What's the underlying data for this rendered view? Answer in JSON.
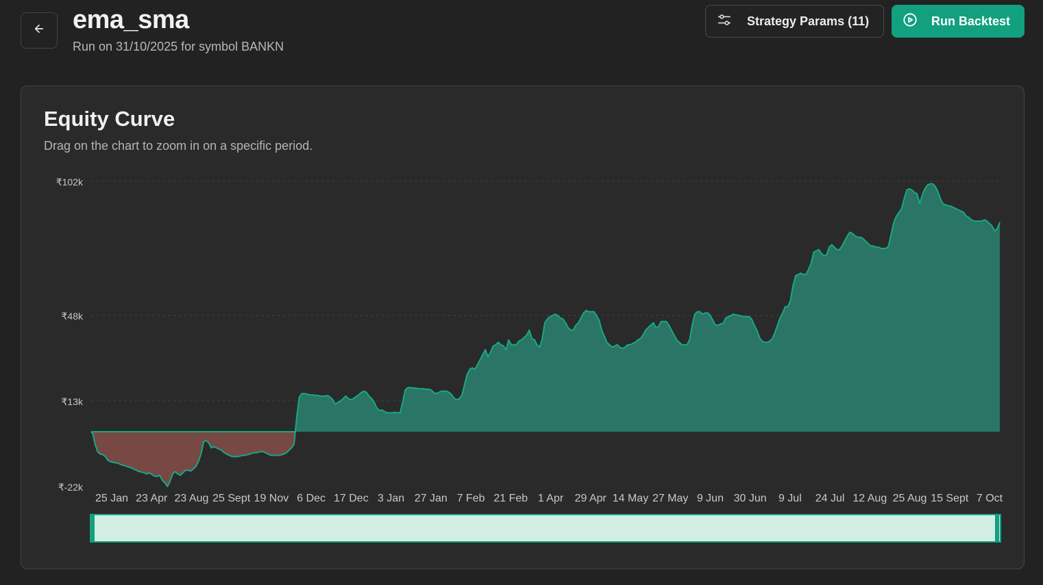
{
  "header": {
    "title": "ema_sma",
    "subtitle": "Run on 31/10/2025 for symbol BANKN",
    "back_icon": "arrow-left-icon",
    "params_label": "Strategy Params (11)",
    "params_icon": "sliders-icon",
    "run_label": "Run Backtest",
    "run_icon": "play-circle-icon"
  },
  "card": {
    "title": "Equity Curve",
    "description": "Drag on the chart to zoom in on a specific period."
  },
  "colors": {
    "positive_fill": "#2a7566",
    "positive_line": "#18a884",
    "negative_fill": "#784844",
    "accent": "#12a07f",
    "brush_fill": "#d2ede4"
  },
  "chart_data": {
    "type": "area",
    "title": "",
    "xlabel": "",
    "ylabel": "",
    "y_tick_labels": [
      "₹102k",
      "₹48k",
      "₹13k",
      "₹-22k"
    ],
    "y_ticks": [
      102000,
      48000,
      13000,
      -22000
    ],
    "ylim": [
      -22000,
      102000
    ],
    "x_tick_labels": [
      "25 Jan",
      "23 Apr",
      "23 Aug",
      "25 Sept",
      "19 Nov",
      "6 Dec",
      "17 Dec",
      "3 Jan",
      "27 Jan",
      "7 Feb",
      "21 Feb",
      "1 Apr",
      "29 Apr",
      "14 May",
      "27 May",
      "9 Jun",
      "30 Jun",
      "9 Jul",
      "24 Jul",
      "12 Aug",
      "25 Aug",
      "15 Sept",
      "7 Oct"
    ],
    "grid": "horizontal-dashed",
    "legend": "none",
    "brush": true,
    "x": [
      0,
      0.7,
      1.5,
      2.5,
      3.5,
      4.5,
      5.5,
      6.5,
      7.5,
      8.5,
      9.5,
      10.5,
      11.5,
      12.5,
      13.5,
      14.5,
      15.5,
      16.5,
      17.5,
      18.5,
      19.5,
      20.5,
      21.5,
      22.5,
      23.5,
      24.5,
      25.5,
      26.5,
      27.5,
      28.5,
      29.5,
      30.5,
      31.5,
      32.5,
      33.5,
      34.5,
      35.5,
      36.5,
      37.5,
      38.5,
      39.5,
      40.5,
      41.5,
      42.5,
      43.5,
      44.5,
      45.5,
      46.5,
      47.5,
      48.5,
      49.5,
      50.5,
      51.5,
      52.5,
      53.5,
      54.5,
      55.5,
      56.5,
      57.5,
      58.5,
      59.5,
      60.5,
      61.5,
      62.5,
      63.5,
      64.5,
      65.5,
      66.5,
      67.5,
      68.5,
      69.5,
      70.5,
      71.5,
      72.5,
      73.5,
      74.5,
      75.5,
      76.5,
      77.5,
      78.5,
      79.5,
      80.5,
      81.5,
      82.5,
      83.5,
      84.5,
      85.5,
      86.5,
      87.5,
      88.5,
      89.5,
      90.5,
      91.5,
      92.5,
      93.5,
      94.5,
      95.5,
      96.5,
      97.5,
      98.5,
      99.5,
      100.5,
      101.5,
      102.5,
      103.5,
      104.5,
      105.5,
      106.5,
      107.5,
      108.5,
      109.5,
      110.5,
      111.5,
      112.5,
      113.5,
      114.5,
      115.5,
      116.5,
      117.5,
      118.5,
      119.5,
      120.5,
      121.5,
      122.5,
      123.5,
      124.5,
      125.5,
      126.5,
      127.5,
      128.5,
      129.5,
      130.5,
      131.5,
      132.5,
      133.5,
      134.5,
      135.5,
      136.5,
      137.5,
      138.5,
      139.5,
      140.5,
      141.5,
      142.5,
      143.5,
      144.5,
      145.5,
      146.5,
      147.5,
      148.5,
      149.5,
      150.5,
      151.5,
      152.5,
      153.5,
      154.5,
      155.5,
      156.5,
      157.5,
      158.5,
      159.5,
      160.5,
      161.5,
      162.5,
      163.5,
      164.5,
      165.5,
      166.5,
      167.5,
      168.5,
      169.5,
      170.5,
      171.5,
      172.5,
      173.5,
      174.5,
      175.5,
      176.5,
      177.5,
      178.5,
      179.5,
      180.5,
      181.5,
      182.5,
      183.5,
      184.5,
      185.5,
      186.5,
      187.5,
      188.5,
      189.5,
      190.5,
      191.5,
      192.5,
      193.5,
      194.5,
      195.5,
      196.5,
      197.5,
      198.5,
      199.5,
      200.5,
      201.5,
      202.5,
      203.5,
      204.5,
      205.5,
      206.5,
      207.5,
      208.5,
      209.5,
      210.5,
      211.5,
      212.5,
      213.5,
      214.5,
      215.5,
      216.5,
      217.5,
      218.5,
      219.5,
      220.5,
      221.5,
      222.5,
      223.5,
      224.5,
      225.5,
      226.5,
      227.5,
      228.5,
      229.5,
      230.5,
      231.5,
      232.5,
      233.5,
      234.5,
      235.5,
      236.5,
      237.5,
      238.5,
      239.5,
      240.5,
      241.5,
      242.5,
      243.5,
      244.5,
      245.5,
      246.5,
      247.5,
      248.5,
      249.5,
      250.5,
      251.5,
      252.5,
      253.5,
      254.5,
      255.5,
      256.5,
      257.5,
      258.5,
      259.5,
      260.5,
      261.5,
      262.5,
      263.5,
      264.5,
      265.5,
      266.5,
      267.5,
      268.5,
      269.5,
      270.5,
      271.5,
      272.5,
      273.5,
      274.5,
      275.5,
      276.5,
      277.5,
      278.5,
      279.5,
      280.5,
      281.5,
      282.5,
      283.5,
      284.5,
      285.5,
      286.5,
      287.5,
      288.5,
      289.5,
      290.5,
      291.5,
      292.5,
      293.5,
      294.5,
      295.5,
      296.5,
      297.5,
      298.5,
      299.5,
      300.5,
      301.5,
      302.5,
      303.5,
      304.5,
      305.5,
      306.5,
      307.5,
      308.5,
      309.5,
      310.5,
      311.5,
      312.5,
      313.5,
      314.5,
      315.5,
      316.5,
      317.5,
      318.5,
      319.5,
      320.5,
      321.5,
      322.5,
      323.5,
      324.5,
      325.5,
      326.5,
      327.5,
      328.5,
      329.5,
      330.5,
      331.5,
      332.5,
      333.5,
      334.5,
      335.5,
      336.5,
      337.5,
      338.5,
      339.5,
      340.5,
      341.5,
      342.5,
      343.5,
      344.5,
      345.5,
      346.5,
      347.5,
      348.5,
      349.5,
      350.5,
      351.5
    ],
    "equity": [
      0,
      -1000,
      -5000,
      -8000,
      -9000,
      -9200,
      -10000,
      -11500,
      -12000,
      -12300,
      -12500,
      -12700,
      -13200,
      -13500,
      -13800,
      -14200,
      -14500,
      -15000,
      -15500,
      -16000,
      -16200,
      -16500,
      -17000,
      -16500,
      -17200,
      -17800,
      -18000,
      -17500,
      -19500,
      -20500,
      -22000,
      -20000,
      -17000,
      -16000,
      -17000,
      -17500,
      -16500,
      -15500,
      -15500,
      -15800,
      -15000,
      -14000,
      -12000,
      -9000,
      -4000,
      -3500,
      -4500,
      -6500,
      -6000,
      -6500,
      -7000,
      -7500,
      -8500,
      -9000,
      -9500,
      -10000,
      -10000,
      -10000,
      -9800,
      -9500,
      -9500,
      -9200,
      -9000,
      -8500,
      -8500,
      -8300,
      -8000,
      -8000,
      -8500,
      -9000,
      -9500,
      -9500,
      -9500,
      -9500,
      -9300,
      -9000,
      -8500,
      -7500,
      -6500,
      -5000,
      6000,
      14500,
      16000,
      16000,
      15800,
      15500,
      15500,
      15300,
      15300,
      15000,
      15000,
      15000,
      15200,
      14500,
      13500,
      11500,
      12500,
      13000,
      14000,
      15000,
      14000,
      13500,
      14000,
      14800,
      15500,
      16500,
      17000,
      16500,
      15000,
      14000,
      12500,
      10000,
      9000,
      9200,
      8500,
      8000,
      8000,
      8000,
      8200,
      8000,
      8000,
      12500,
      17500,
      18500,
      18500,
      18300,
      18300,
      18000,
      18000,
      18000,
      17800,
      17800,
      17500,
      16500,
      16000,
      16500,
      17000,
      17000,
      17000,
      16500,
      15500,
      14000,
      13500,
      14000,
      15500,
      20000,
      24000,
      26000,
      26500,
      26000,
      28000,
      30000,
      32000,
      34000,
      31000,
      33000,
      35500,
      36000,
      37000,
      36000,
      35500,
      34000,
      38000,
      36000,
      36000,
      36000,
      37500,
      38000,
      39000,
      40000,
      42000,
      38500,
      38000,
      36000,
      35000,
      38500,
      45000,
      46500,
      47500,
      48000,
      48500,
      48000,
      47000,
      46500,
      45000,
      43000,
      42000,
      42000,
      44000,
      45000,
      47000,
      49000,
      50000,
      49500,
      49500,
      49500,
      48000,
      46000,
      42000,
      39500,
      37000,
      36000,
      35000,
      35500,
      36000,
      35000,
      34500,
      35000,
      36000,
      36000,
      36500,
      37000,
      38000,
      38500,
      40000,
      42000,
      43000,
      44000,
      45000,
      43000,
      43500,
      45500,
      45500,
      45500,
      44000,
      42000,
      40000,
      38000,
      37000,
      36000,
      36000,
      36000,
      38000,
      44000,
      48500,
      49500,
      49500,
      48500,
      49000,
      49000,
      48000,
      46000,
      44000,
      44000,
      44500,
      44800,
      47000,
      47500,
      48000,
      48500,
      48200,
      48000,
      47800,
      47500,
      47500,
      47500,
      46500,
      44000,
      42000,
      39000,
      37500,
      37000,
      37000,
      37500,
      38500,
      41000,
      44000,
      47000,
      49000,
      51500,
      51500,
      54000,
      60000,
      64000,
      64500,
      65000,
      64500,
      64500,
      66500,
      69000,
      73500,
      74000,
      74500,
      73000,
      72000,
      72500,
      75500,
      76500,
      75500,
      74500,
      74500,
      76000,
      78000,
      80000,
      81500,
      81000,
      80000,
      79500,
      79500,
      79000,
      78000,
      77000,
      76000,
      76000,
      75500,
      75500,
      75000,
      75000,
      75000,
      76000,
      81000,
      85500,
      88000,
      89500,
      91000,
      95000,
      98500,
      99000,
      98500,
      97500,
      97000,
      93000,
      96500,
      99000,
      100500,
      101000,
      101000,
      100000,
      98000,
      95000,
      93000,
      92500,
      92200,
      92000,
      91500,
      91000,
      90500,
      90000,
      89500,
      88000,
      87500,
      86500,
      86000,
      86000,
      86000,
      86000,
      86500,
      86000,
      85000,
      84000,
      82000,
      83000,
      85500,
      89000,
      91500,
      91000,
      90500,
      90500,
      90500,
      91500,
      92500,
      91500,
      92000,
      94000,
      94000,
      94200,
      94300,
      95000,
      96500,
      95000,
      93000,
      91500,
      90000
    ]
  }
}
